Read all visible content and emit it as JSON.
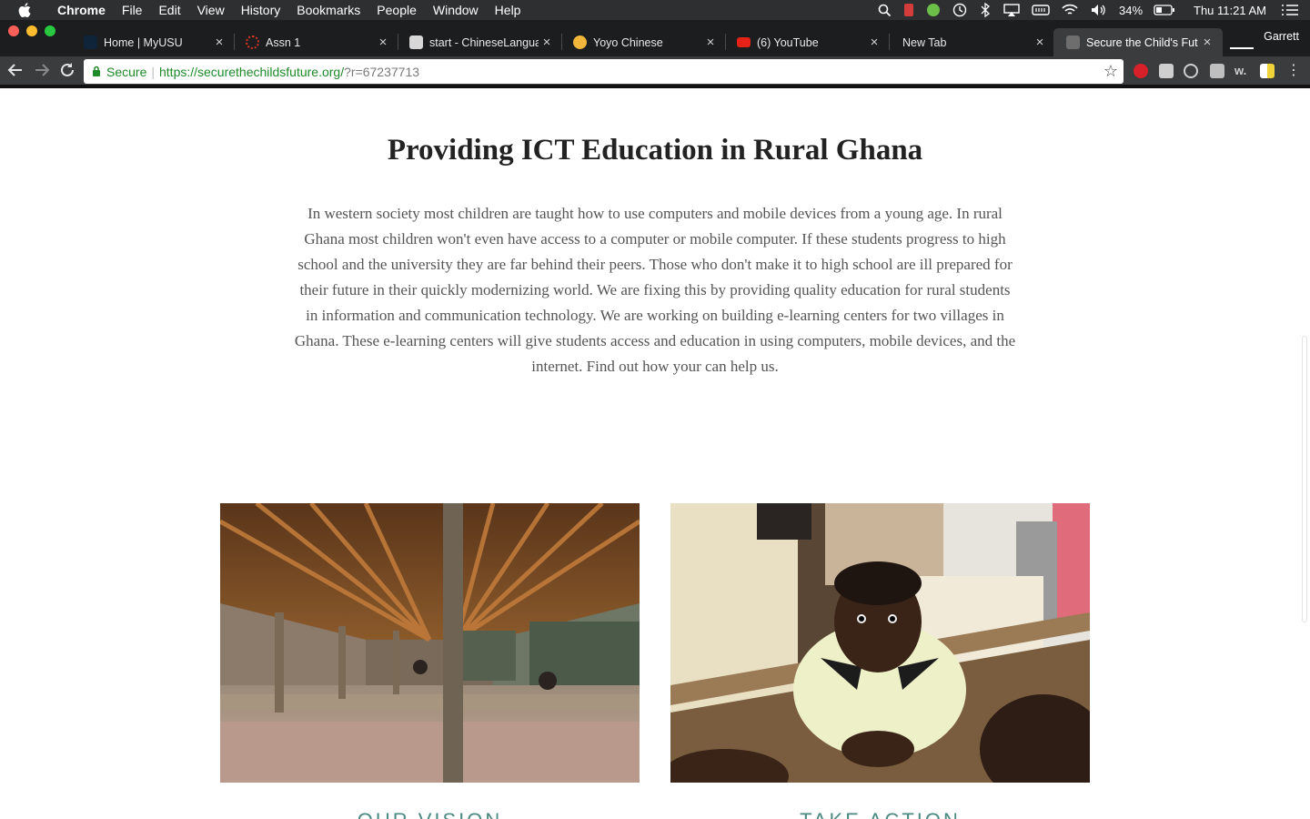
{
  "menubar": {
    "app": "Chrome",
    "items": [
      "File",
      "Edit",
      "View",
      "History",
      "Bookmarks",
      "People",
      "Window",
      "Help"
    ],
    "battery": "34%",
    "clock": "Thu 11:21 AM"
  },
  "tabs": [
    {
      "label": "Home | MyUSU",
      "favicon_color": "#0f2439"
    },
    {
      "label": "Assn 1",
      "favicon_color": "#d9362b"
    },
    {
      "label": "start - ChineseLangua",
      "favicon_color": "#d7d7d7"
    },
    {
      "label": "Yoyo Chinese",
      "favicon_color": "#f0b53a"
    },
    {
      "label": "(6) YouTube",
      "favicon_color": "#e62117"
    },
    {
      "label": "New Tab",
      "favicon_color": ""
    },
    {
      "label": "Secure the Child's Fut",
      "favicon_color": "#6e6e6e"
    }
  ],
  "profile": "Garrett",
  "address": {
    "secure_label": "Secure",
    "url_main": "https://securethechildsfuture.org/",
    "url_query": "?r=67237713"
  },
  "page": {
    "heading": "Providing ICT Education in Rural Ghana",
    "intro": "In western society most children are taught how to use computers and mobile devices from a young age. In rural Ghana most children won't even have access to a computer or mobile computer. If these students progress to high school and the university they are far behind their peers. Those who don't make it to high school are ill prepared for their future in their quickly modernizing world. We are fixing this by providing quality education for rural students in information and communication technology. We are working on building e-learning centers for two villages in Ghana. These e-learning centers will give students access and education in using computers, mobile devices, and the internet. Find out how your can help us.",
    "cards": [
      {
        "caption": "OUR VISION"
      },
      {
        "caption": "TAKE ACTION"
      }
    ]
  },
  "colors": {
    "secure_green": "#1e8a2a",
    "caption_teal": "#4b8a82",
    "menubar_bg": "#2d2f31",
    "toolbar_bg": "#3b3c3e"
  }
}
